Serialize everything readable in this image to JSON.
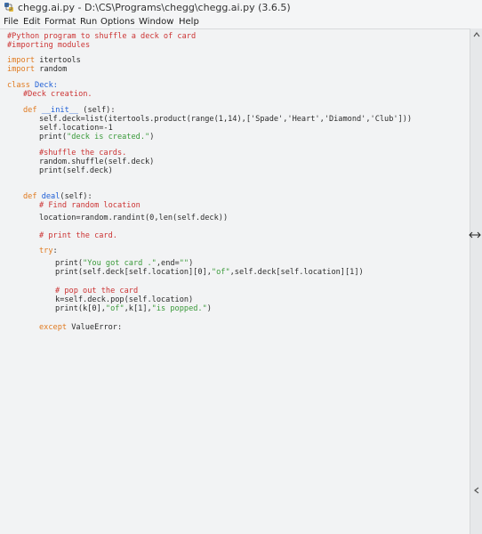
{
  "window": {
    "title": "chegg.ai.py - D:\\CS\\Programs\\chegg\\chegg.ai.py (3.6.5)",
    "app_icon": "python-idle-icon"
  },
  "menubar": {
    "items": [
      "File",
      "Edit",
      "Format",
      "Run",
      "Options",
      "Window",
      "Help"
    ]
  },
  "editor": {
    "lines": {
      "l1": "#Python program to shuffle a deck of card",
      "l2": "#importing modules",
      "l4a": "import",
      "l4b": " itertools",
      "l5a": "import",
      "l5b": " random",
      "l7a": "class",
      "l7b": " Deck:",
      "l8": "#Deck creation.",
      "l10a": "def",
      "l10b": " __init__",
      "l10c": " (self):",
      "l11": "self.deck=list(itertools.product(range(1,14),['Spade','Heart','Diamond','Club']))",
      "l12": "self.location=-1",
      "l13a": "print(",
      "l13b": "\"deck is created.\"",
      "l13c": ")",
      "l15": "#shuffle the cards.",
      "l16": "random.shuffle(self.deck)",
      "l17": "print(self.deck)",
      "l20a": "def",
      "l20b": " deal",
      "l20c": "(self):",
      "l21": "# Find random location",
      "l22": "location=random.randint(0,len(self.deck))",
      "l24": "# print the card.",
      "l25a": "try",
      "l25b": ":",
      "l26a": "print(",
      "l26b": "\"You got card .\"",
      "l26c": ",end=",
      "l26d": "\"\"",
      "l26e": ")",
      "l27a": "print(self.deck[self.location][0],",
      "l27b": "\"of\"",
      "l27c": ",self.deck[self.location][1])",
      "l29": "# pop out the card",
      "l30": "k=self.deck.pop(self.location)",
      "l31a": "print(k[0],",
      "l31b": "\"of\"",
      "l31c": ",k[1],",
      "l31d": "\"is popped.\"",
      "l31e": ")",
      "l33a": "except",
      "l33b": " ValueError:"
    }
  },
  "scrollbar": {
    "up_arrow": "chevron-up-icon",
    "down_arrow": "chevron-down-icon"
  }
}
